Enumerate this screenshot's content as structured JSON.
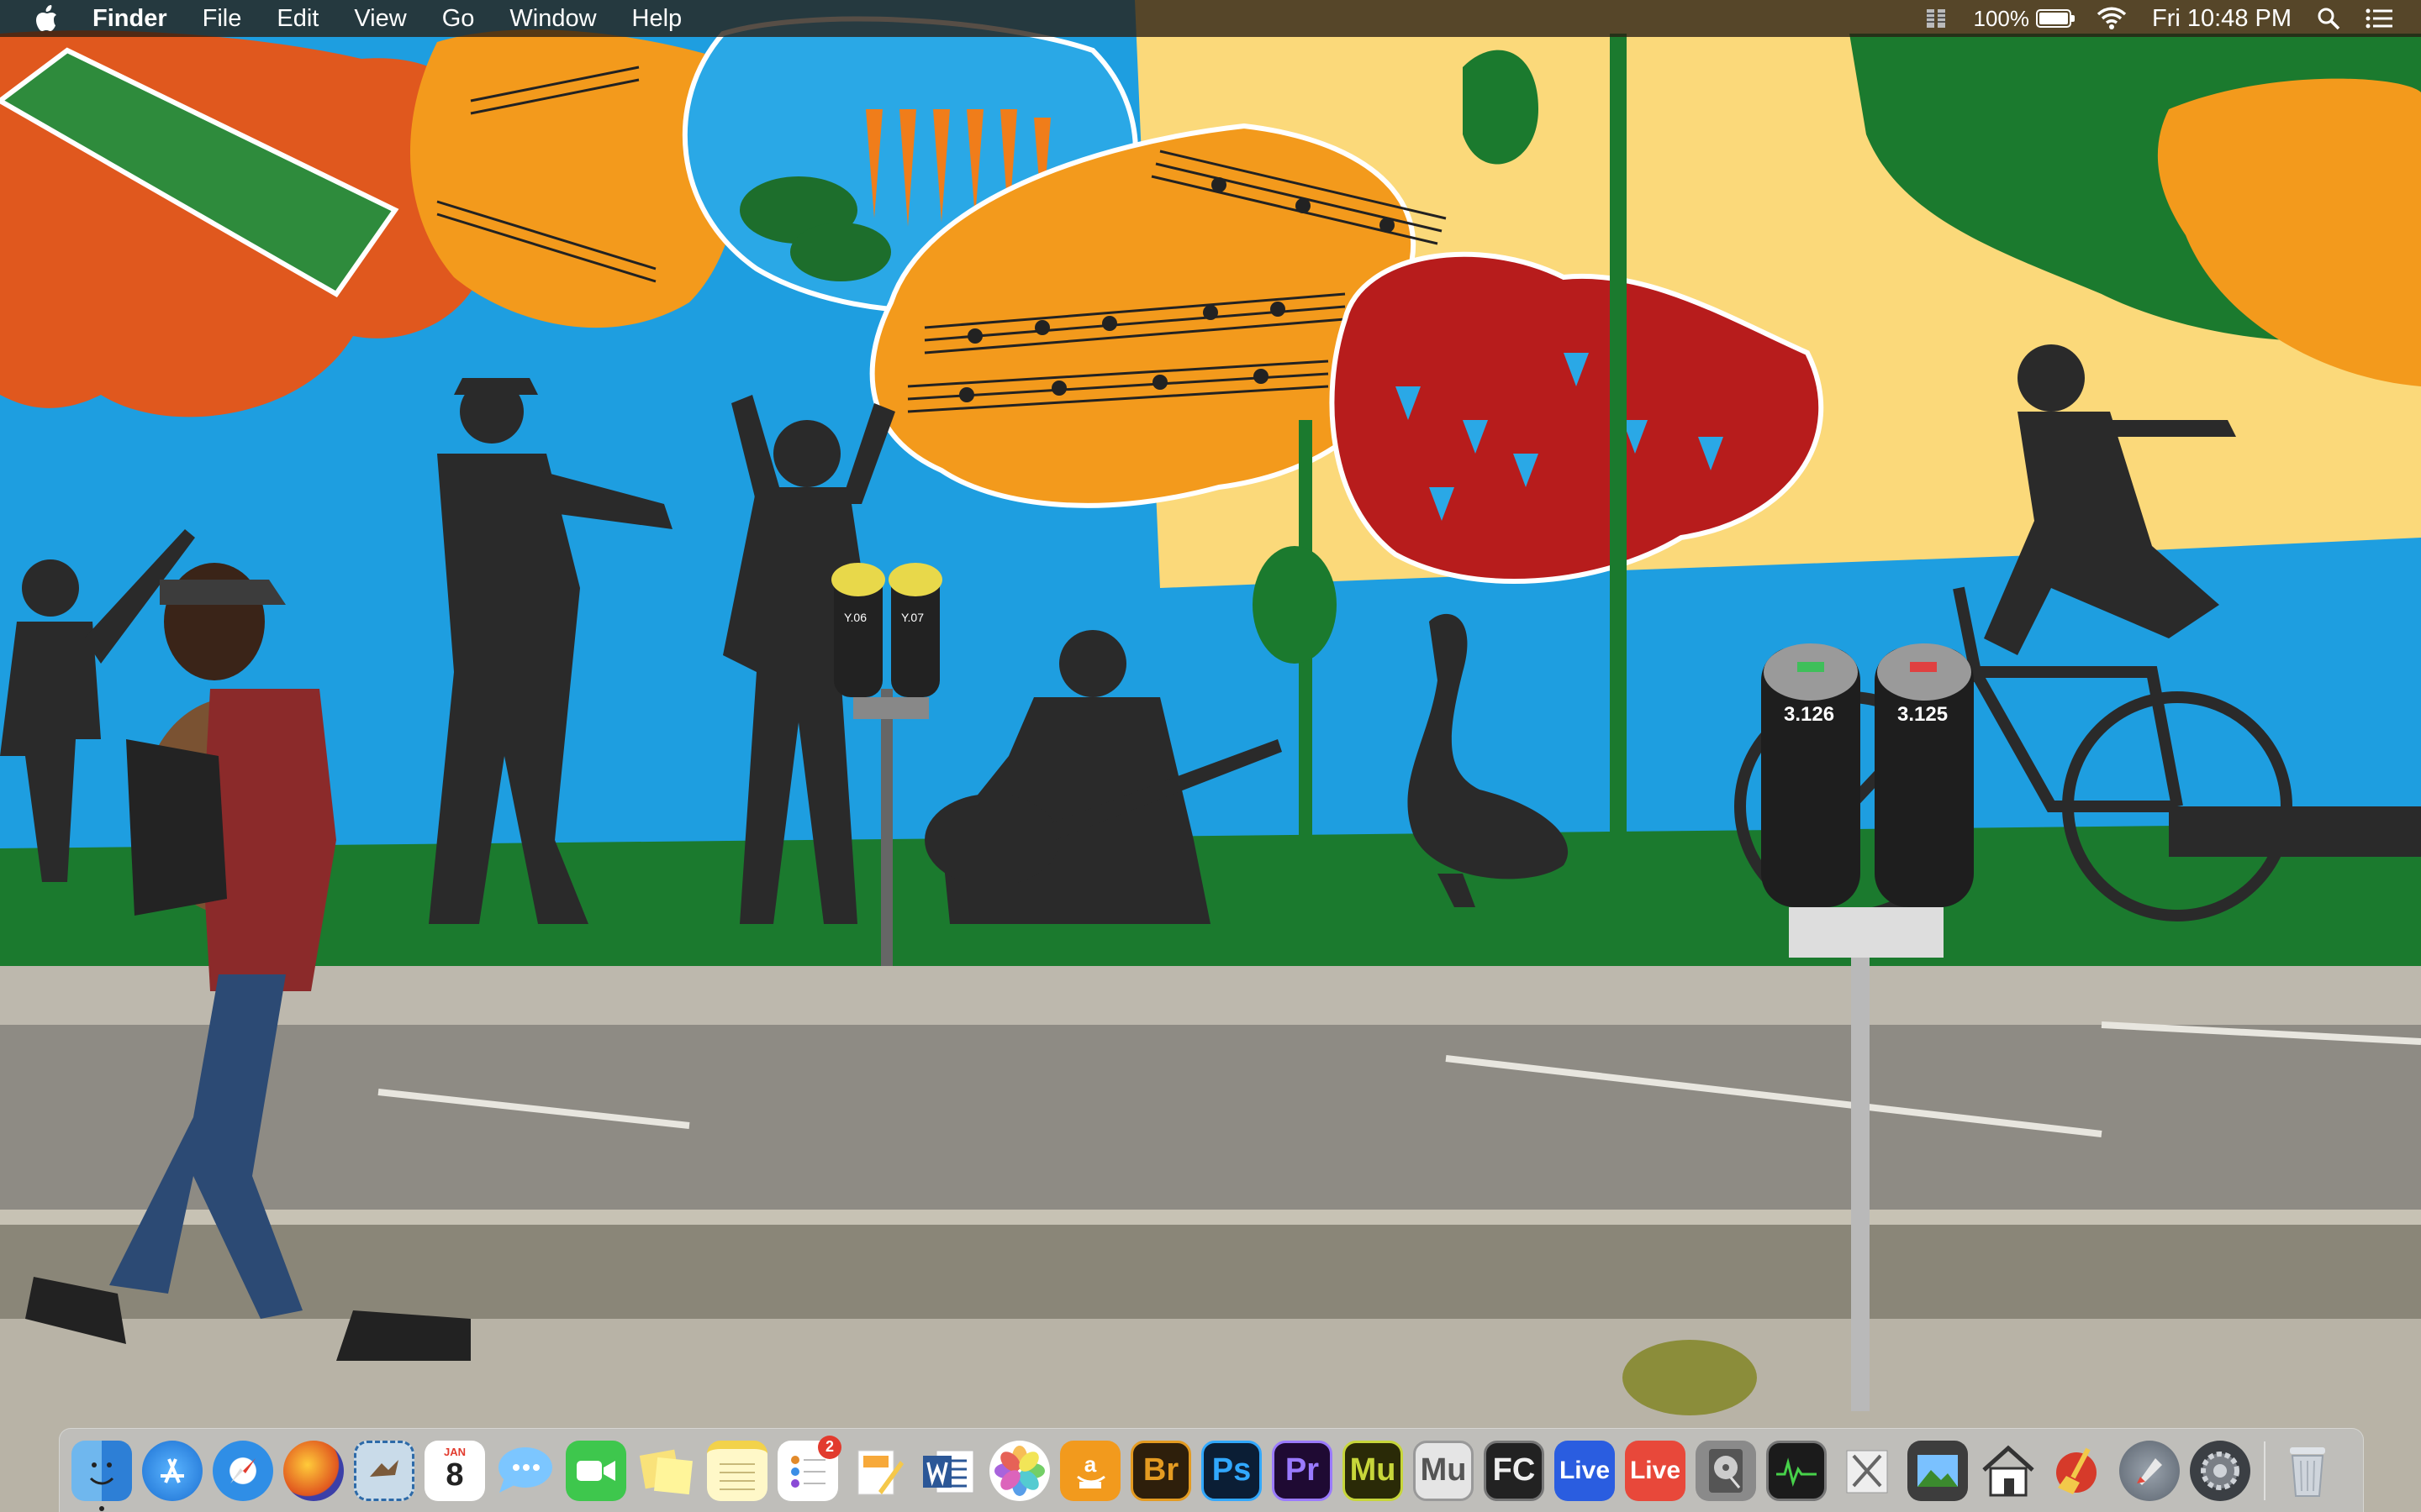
{
  "menubar": {
    "app_name": "Finder",
    "menus": [
      "File",
      "Edit",
      "View",
      "Go",
      "Window",
      "Help"
    ],
    "battery_percent": "100%",
    "battery_level": 1.0,
    "clock": "Fri 10:48 PM"
  },
  "wallpaper": {
    "meter_left_labels": [
      "Y.06",
      "Y.07"
    ],
    "meter_right_labels": [
      "3.126",
      "3.125"
    ]
  },
  "dock": {
    "calendar_month": "JAN",
    "calendar_day": "8",
    "reminders_badge": "2",
    "bridge_label": "Br",
    "photoshop_label": "Ps",
    "premiere_label": "Pr",
    "muse_label": "Mu",
    "mu_label": "Mu",
    "finalcut_label": "FC",
    "live1_label": "Live",
    "live2_label": "Live"
  },
  "colors": {
    "wall_blue": "#1e9ee0",
    "wall_orange": "#f39a1c",
    "wall_yellow": "#fbd97a",
    "wall_green": "#1b7a2e",
    "wall_red": "#c8281e",
    "silhouette": "#2a2a2a"
  }
}
